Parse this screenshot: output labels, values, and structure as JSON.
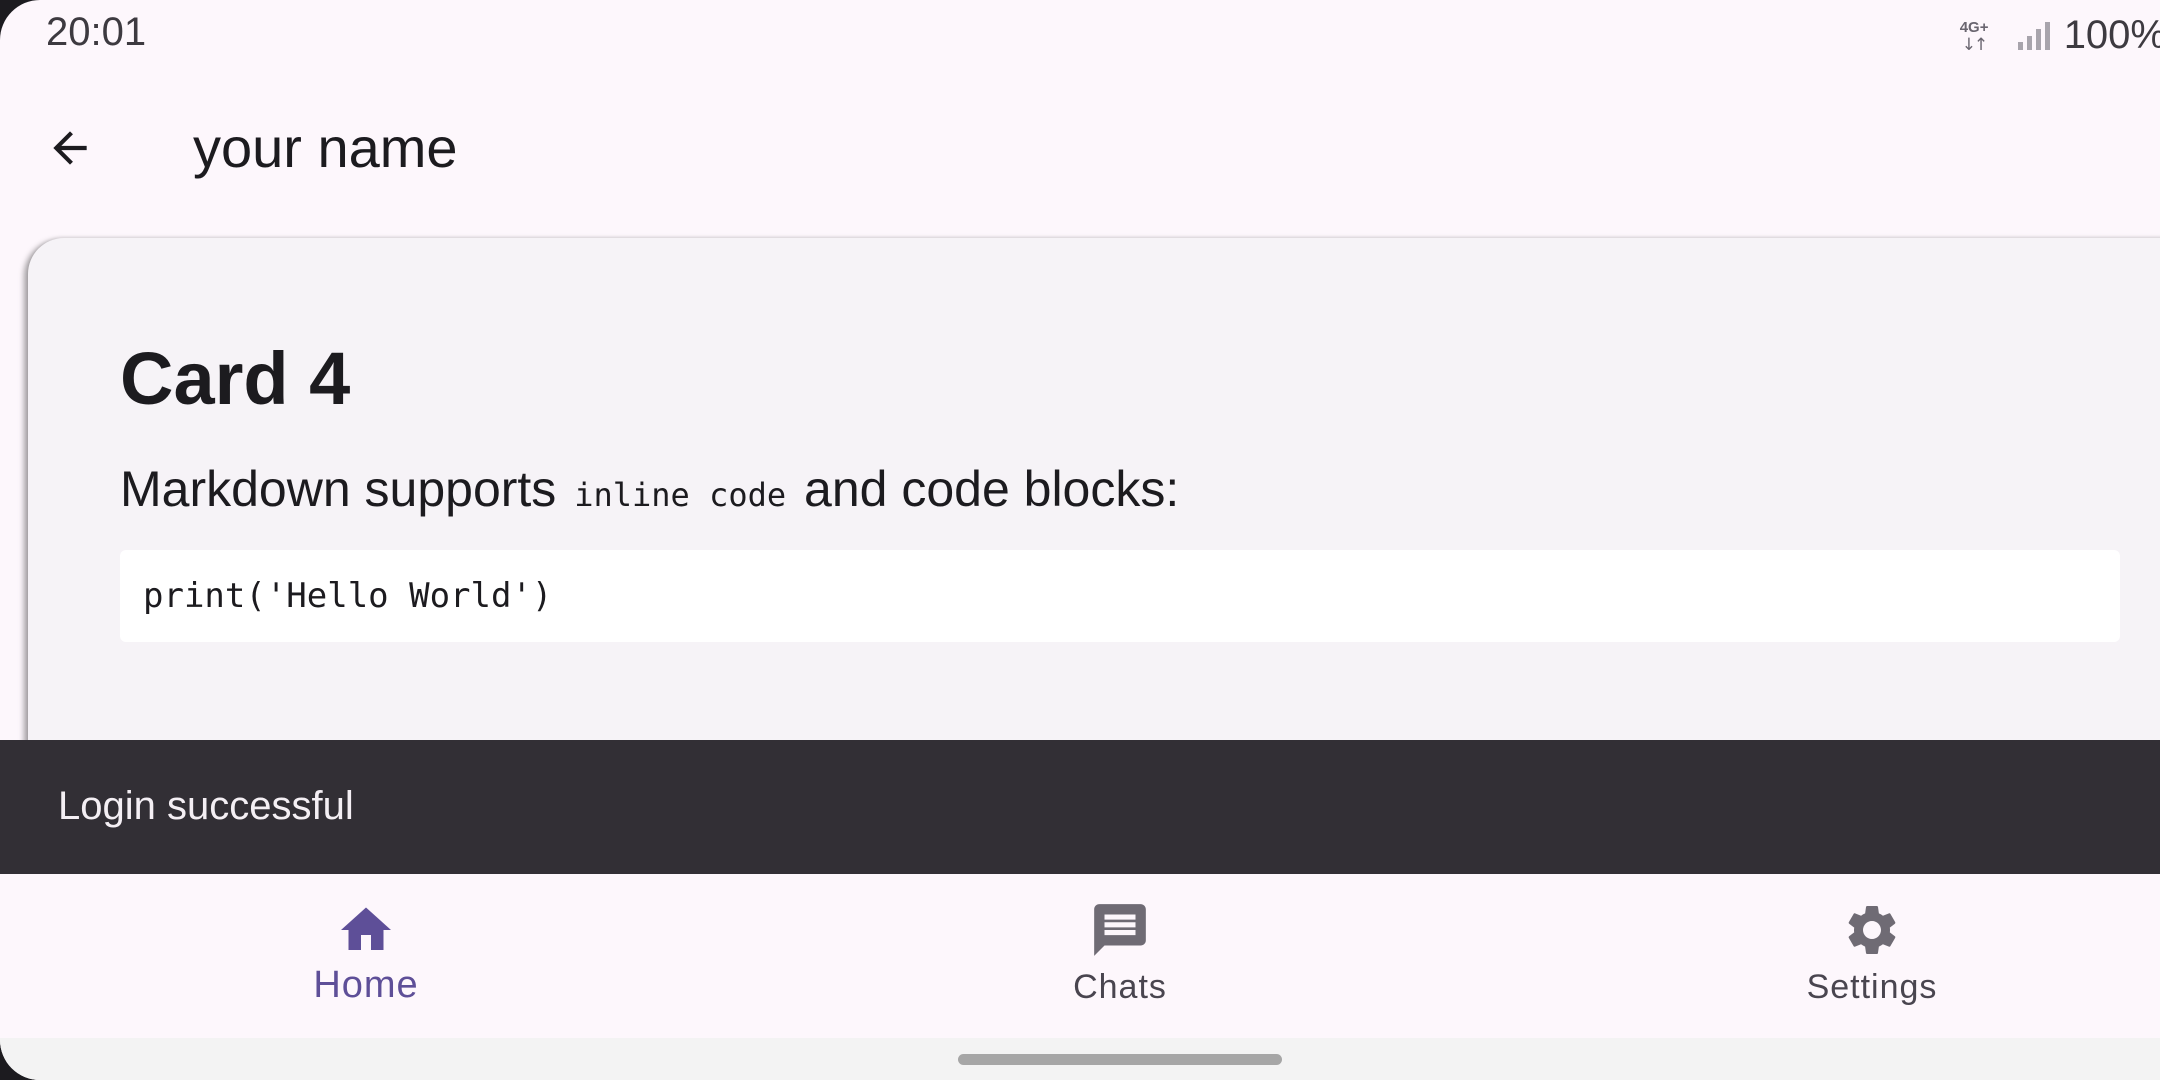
{
  "status_bar": {
    "time": "20:01",
    "network_label": "4G+",
    "network_arrows": "↓↑",
    "battery": "100%",
    "icons": [
      "network-4g-icon",
      "signal-icon"
    ]
  },
  "app_bar": {
    "back_icon": "arrow-back-icon",
    "title": "your name"
  },
  "card": {
    "title": "Card 4",
    "paragraph_before": "Markdown supports ",
    "inline_code": "inline code",
    "paragraph_after": " and code blocks:",
    "code_block": "print('Hello World')"
  },
  "snackbar": {
    "message": "Login successful"
  },
  "bottom_nav": {
    "items": [
      {
        "label": "Home",
        "icon": "home-icon",
        "active": true
      },
      {
        "label": "Chats",
        "icon": "chat-icon",
        "active": false
      },
      {
        "label": "Settings",
        "icon": "gear-icon",
        "active": false
      }
    ]
  },
  "colors": {
    "accent": "#5e4f98",
    "background": "#fdf7fc",
    "card": "#f6f3f7",
    "snackbar": "#322f35",
    "inactive_icon": "#6f6b74"
  }
}
